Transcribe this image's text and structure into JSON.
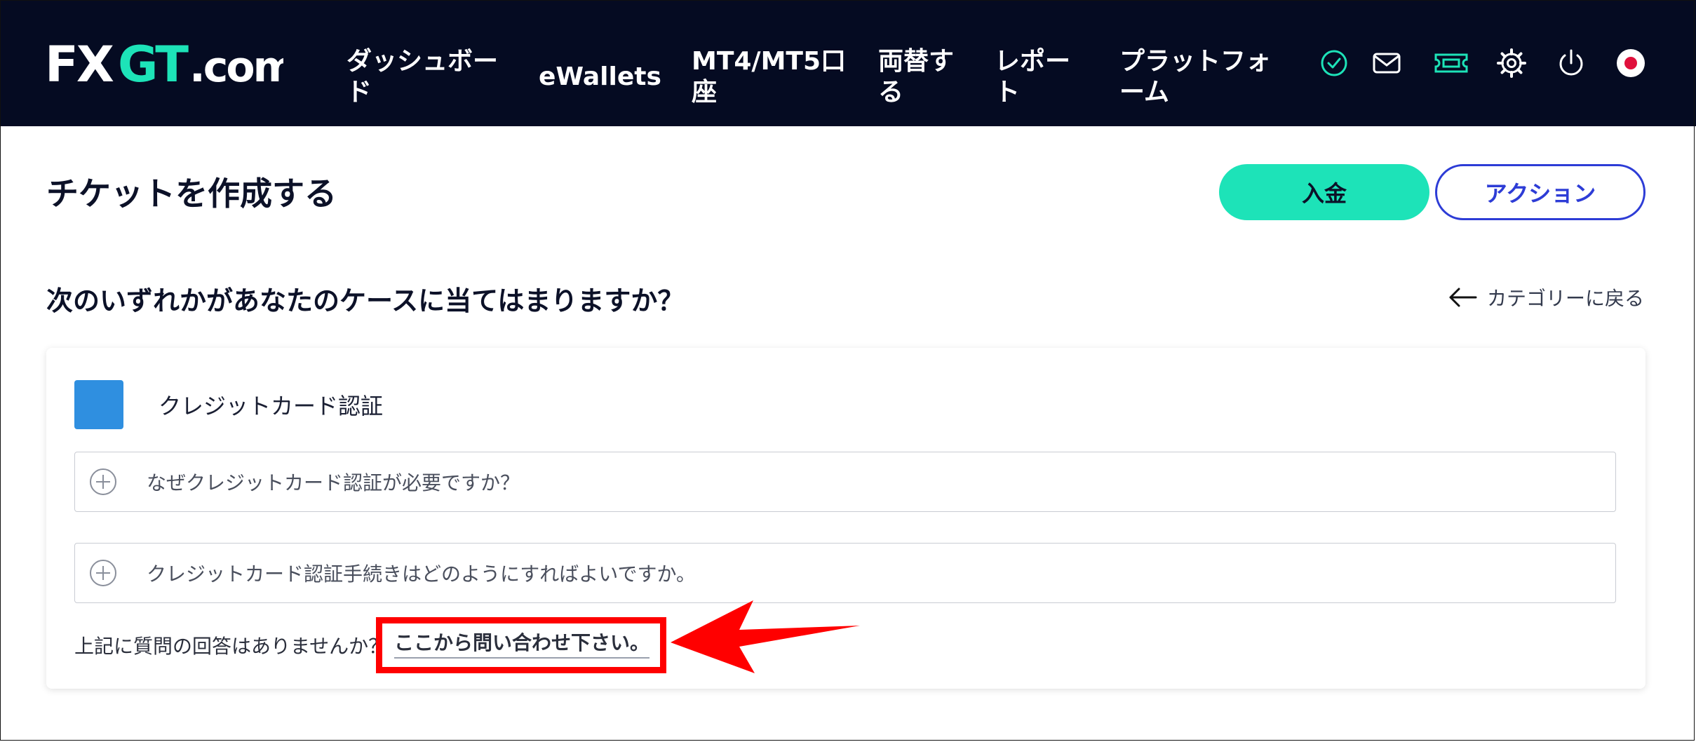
{
  "header": {
    "logo_text": "FXGT.com",
    "nav": {
      "dashboard": "ダッシュボード",
      "ewallets": "eWallets",
      "mt": "MT4/MT5口座",
      "exchange": "両替する",
      "report": "レポート",
      "platform": "プラットフォーム"
    },
    "icons": [
      "verified-check-icon",
      "mail-icon",
      "ticket-icon",
      "gear-icon",
      "power-icon",
      "japan-flag-icon"
    ]
  },
  "page": {
    "title": "チケットを作成する",
    "deposit_button": "入金",
    "action_button": "アクション",
    "question_heading": "次のいずれかがあなたのケースに当てはまりますか？",
    "back_link": "カテゴリーに戻る"
  },
  "category": {
    "title": "クレジットカード認証",
    "icon_color": "#2f8fe0",
    "faqs": [
      {
        "text": "なぜクレジットカード認証が必要ですか？"
      },
      {
        "text": "クレジットカード認証手続きはどのようにすればよいですか。"
      }
    ],
    "footer_question": "上記に質問の回答はありませんか？",
    "contact_link": "ここから問い合わせ下さい。"
  },
  "colors": {
    "header_bg": "#050b22",
    "accent_green": "#1de3b8",
    "accent_blue": "#2d3cd6",
    "annotation_red": "#ff0000"
  }
}
